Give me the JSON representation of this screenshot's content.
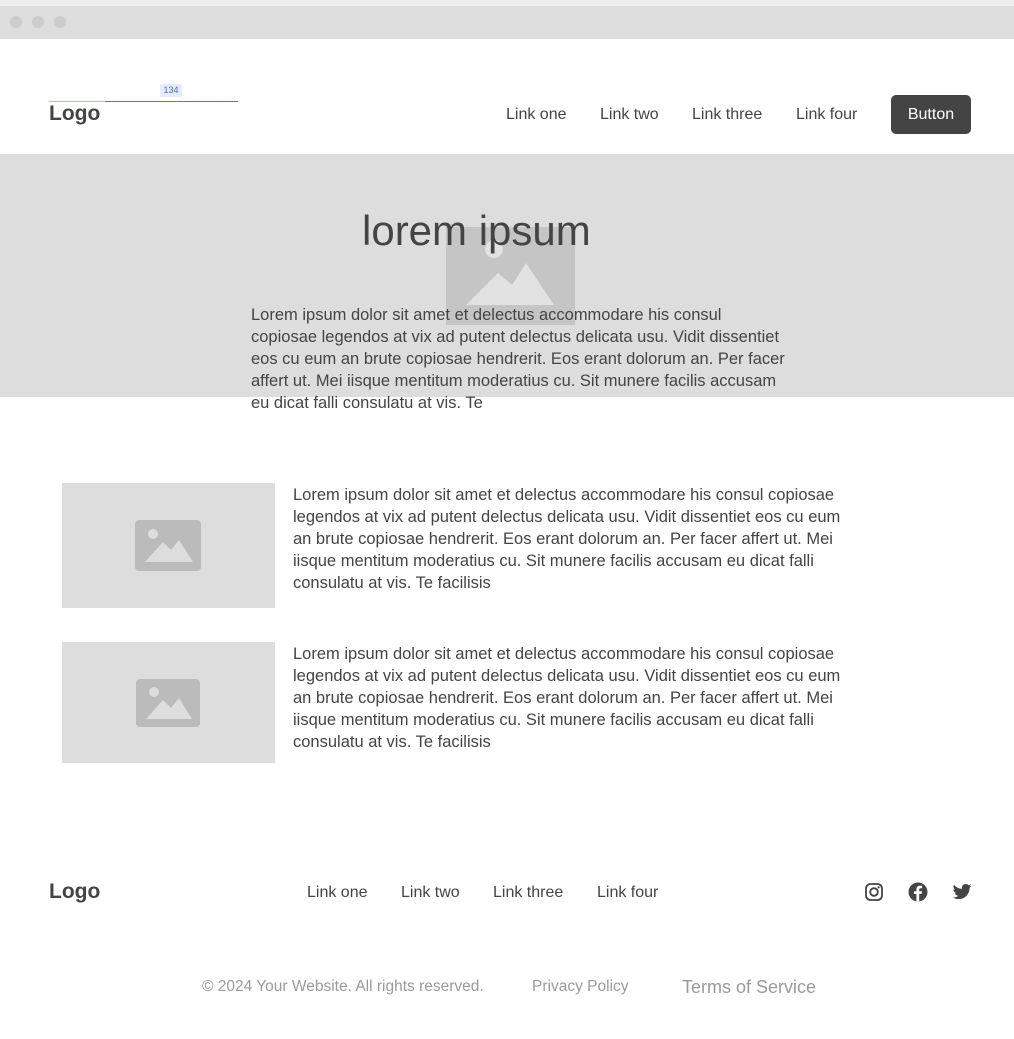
{
  "header": {
    "logo": "Logo",
    "nav": [
      "Link one",
      "Link two",
      "Link three",
      "Link four"
    ],
    "button_label": "Button",
    "measure_label": "134"
  },
  "hero": {
    "title": "lorem ipsum",
    "text": "Lorem ipsum dolor sit amet et delectus accommodare his consul copiosae legendos at vix ad putent delectus delicata usu. Vidit dissentiet eos cu eum an brute copiosae hendrerit. Eos erant dolorum an. Per facer affert ut. Mei iisque mentitum moderatius cu. Sit munere facilis accusam eu dicat falli consulatu at vis. Te",
    "image_icon": "image-placeholder-icon"
  },
  "features": [
    {
      "image_icon": "image-placeholder-icon",
      "text": "Lorem ipsum dolor sit amet et delectus accommodare his consul copiosae legendos at vix ad putent delectus delicata usu. Vidit dissentiet eos cu eum an brute copiosae hendrerit. Eos erant dolorum an. Per facer affert ut. Mei iisque mentitum moderatius cu. Sit munere facilis accusam eu dicat falli consulatu at vis. Te facilisis"
    },
    {
      "image_icon": "image-placeholder-icon",
      "text": "Lorem ipsum dolor sit amet et delectus accommodare his consul copiosae legendos at vix ad putent delectus delicata usu. Vidit dissentiet eos cu eum an brute copiosae hendrerit. Eos erant dolorum an. Per facer affert ut. Mei iisque mentitum moderatius cu. Sit munere facilis accusam eu dicat falli consulatu at vis. Te facilisis"
    }
  ],
  "footer": {
    "logo": "Logo",
    "nav": [
      "Link one",
      "Link two",
      "Link three",
      "Link four"
    ],
    "social_icons": [
      "instagram-icon",
      "facebook-icon",
      "twitter-icon"
    ],
    "copyright": "© 2024 Your Website. All rights reserved.",
    "privacy": "Privacy Policy",
    "terms": "Terms of Service"
  },
  "colors": {
    "text": "#444444",
    "placeholder_bg": "#dddddd",
    "placeholder_icon": "#bbbbbb",
    "button_bg": "#444444",
    "button_text": "#ffffff",
    "muted_text": "#9a9a9a"
  }
}
